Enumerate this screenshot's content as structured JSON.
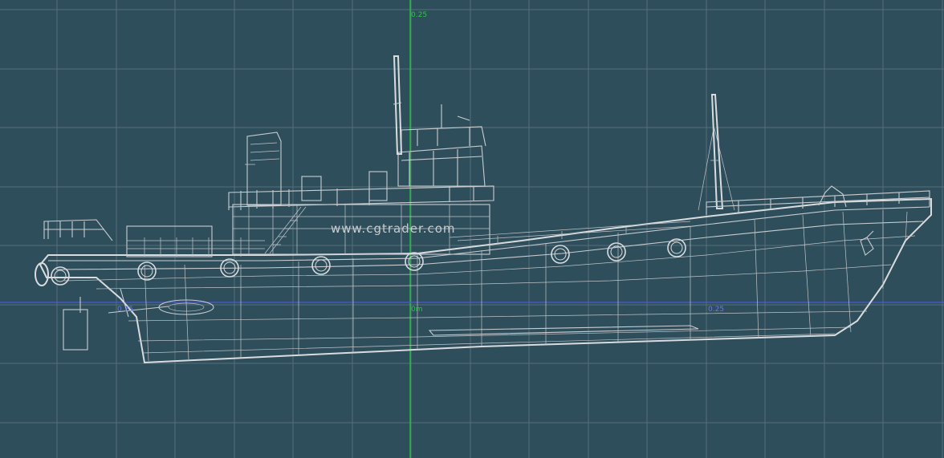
{
  "viewport": {
    "type": "3d-wireframe-side-view",
    "background_color": "#2f4e5c",
    "grid_color": "#566e79",
    "wire_color": "#c9cdd0",
    "vertical_axis_color": "#22c93a",
    "horizontal_axis_color": "#4a5ad8",
    "grid": true
  },
  "axis_labels": {
    "vertical_top": "0.25",
    "origin": "0m",
    "horizontal_right": "0.25",
    "horizontal_left": "0.25"
  },
  "watermark": "www.cgtrader.com",
  "model": {
    "subject": "tugboat",
    "icon": "ship-wireframe-icon"
  }
}
